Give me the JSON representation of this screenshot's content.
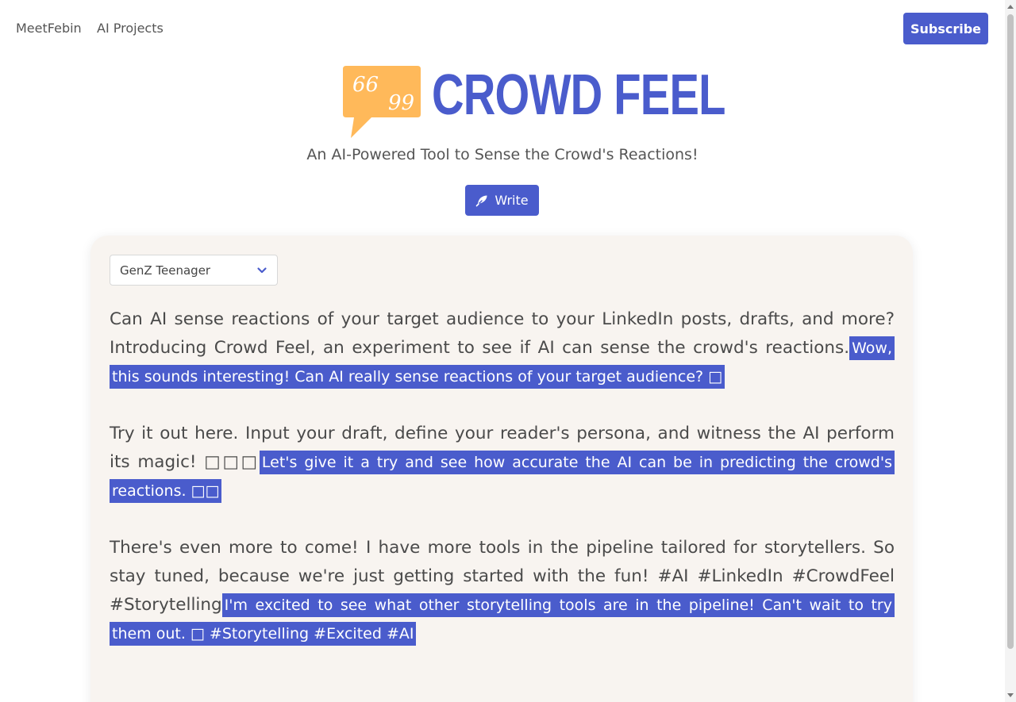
{
  "nav": {
    "links": [
      "MeetFebin",
      "AI Projects"
    ],
    "subscribe_label": "Subscribe"
  },
  "brand": {
    "name": "CROWD FEEL",
    "logo_open_quote": "66",
    "logo_close_quote": "99",
    "tagline": "An AI-Powered Tool to Sense the Crowd's Reactions!"
  },
  "write_button": {
    "label": "Write",
    "icon": "feather-icon"
  },
  "persona": {
    "selected": "GenZ Teenager",
    "icon": "chevron-down-icon"
  },
  "post": {
    "paragraphs": [
      {
        "text": "Can AI sense reactions of your target audience to your LinkedIn posts, drafts, and more? Introducing Crowd Feel, an experiment to see if AI can sense the crowd's reactions.",
        "reaction": "Wow, this sounds interesting! Can AI really sense reactions of your target audience? □"
      },
      {
        "text": "Try it out here. Input your draft, define your reader's persona, and witness the AI perform its magic! □□□",
        "reaction": "Let's give it a try and see how accurate the AI can be in predicting the crowd's reactions. □□"
      },
      {
        "text": "There's even more to come! I have more tools in the pipeline tailored for storytellers. So stay tuned, because we're just getting started with the fun! #AI #LinkedIn #CrowdFeel #Storytelling",
        "reaction": "I'm excited to see what other storytelling tools are in the pipeline! Can't wait to try them out. □ #Storytelling #Excited #AI"
      }
    ]
  },
  "colors": {
    "accent": "#4a5ccc",
    "logo_bubble": "#ffb95a",
    "card_background": "#f8f4f0"
  }
}
